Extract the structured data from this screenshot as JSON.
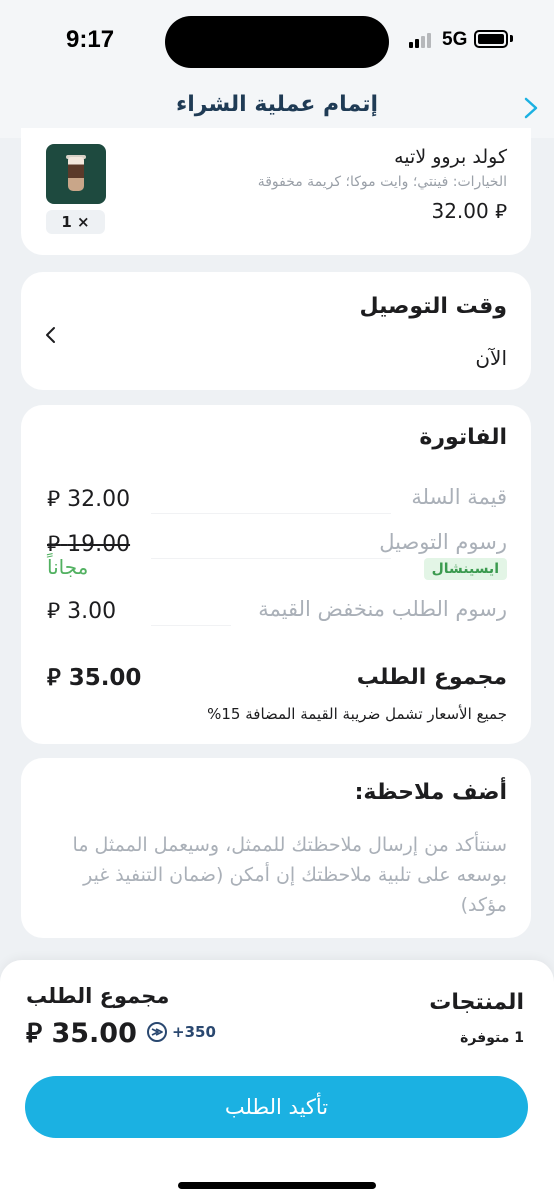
{
  "status_bar": {
    "time": "9:17",
    "network": "5G"
  },
  "header": {
    "title": "إتمام عملية الشراء",
    "back_icon": "chevron-right-icon"
  },
  "product": {
    "name": "كولد بروو لاتيه",
    "options": "الخيارات: فينتي؛ وايت موكا؛ كريمة مخفوقة",
    "price": "32.00",
    "currency_symbol": "⃁",
    "quantity": "1 ×"
  },
  "delivery": {
    "title": "وقت التوصيل",
    "value": "الآن"
  },
  "invoice": {
    "title": "الفاتورة",
    "rows": [
      {
        "label": "قيمة السلة",
        "value": "32.00"
      },
      {
        "label": "رسوم التوصيل",
        "value": "19.00",
        "badge": "ايسينشال",
        "free": "مجاناً"
      },
      {
        "label": "رسوم الطلب منخفض القيمة",
        "value": "3.00"
      }
    ],
    "total_label": "مجموع الطلب",
    "total_value": "35.00",
    "vat_note": "جميع الأسعار تشمل ضريبة القيمة المضافة 15%"
  },
  "note": {
    "title": "أضف ملاحظة:",
    "placeholder": "سنتأكد من إرسال ملاحظتك للممثل، وسيعمل الممثل ما بوسعه على تلبية ملاحظتك إن أمكن (ضمان التنفيذ غير مؤكد)"
  },
  "bottom_bar": {
    "products_label": "المنتجات",
    "products_count": "1 متوفرة",
    "total_label": "مجموع الطلب",
    "total_value": "35.00",
    "points": "+350",
    "confirm_label": "تأكيد الطلب"
  },
  "colors": {
    "accent": "#1bb1e2",
    "success": "#52b161",
    "heading": "#1f3b55"
  }
}
